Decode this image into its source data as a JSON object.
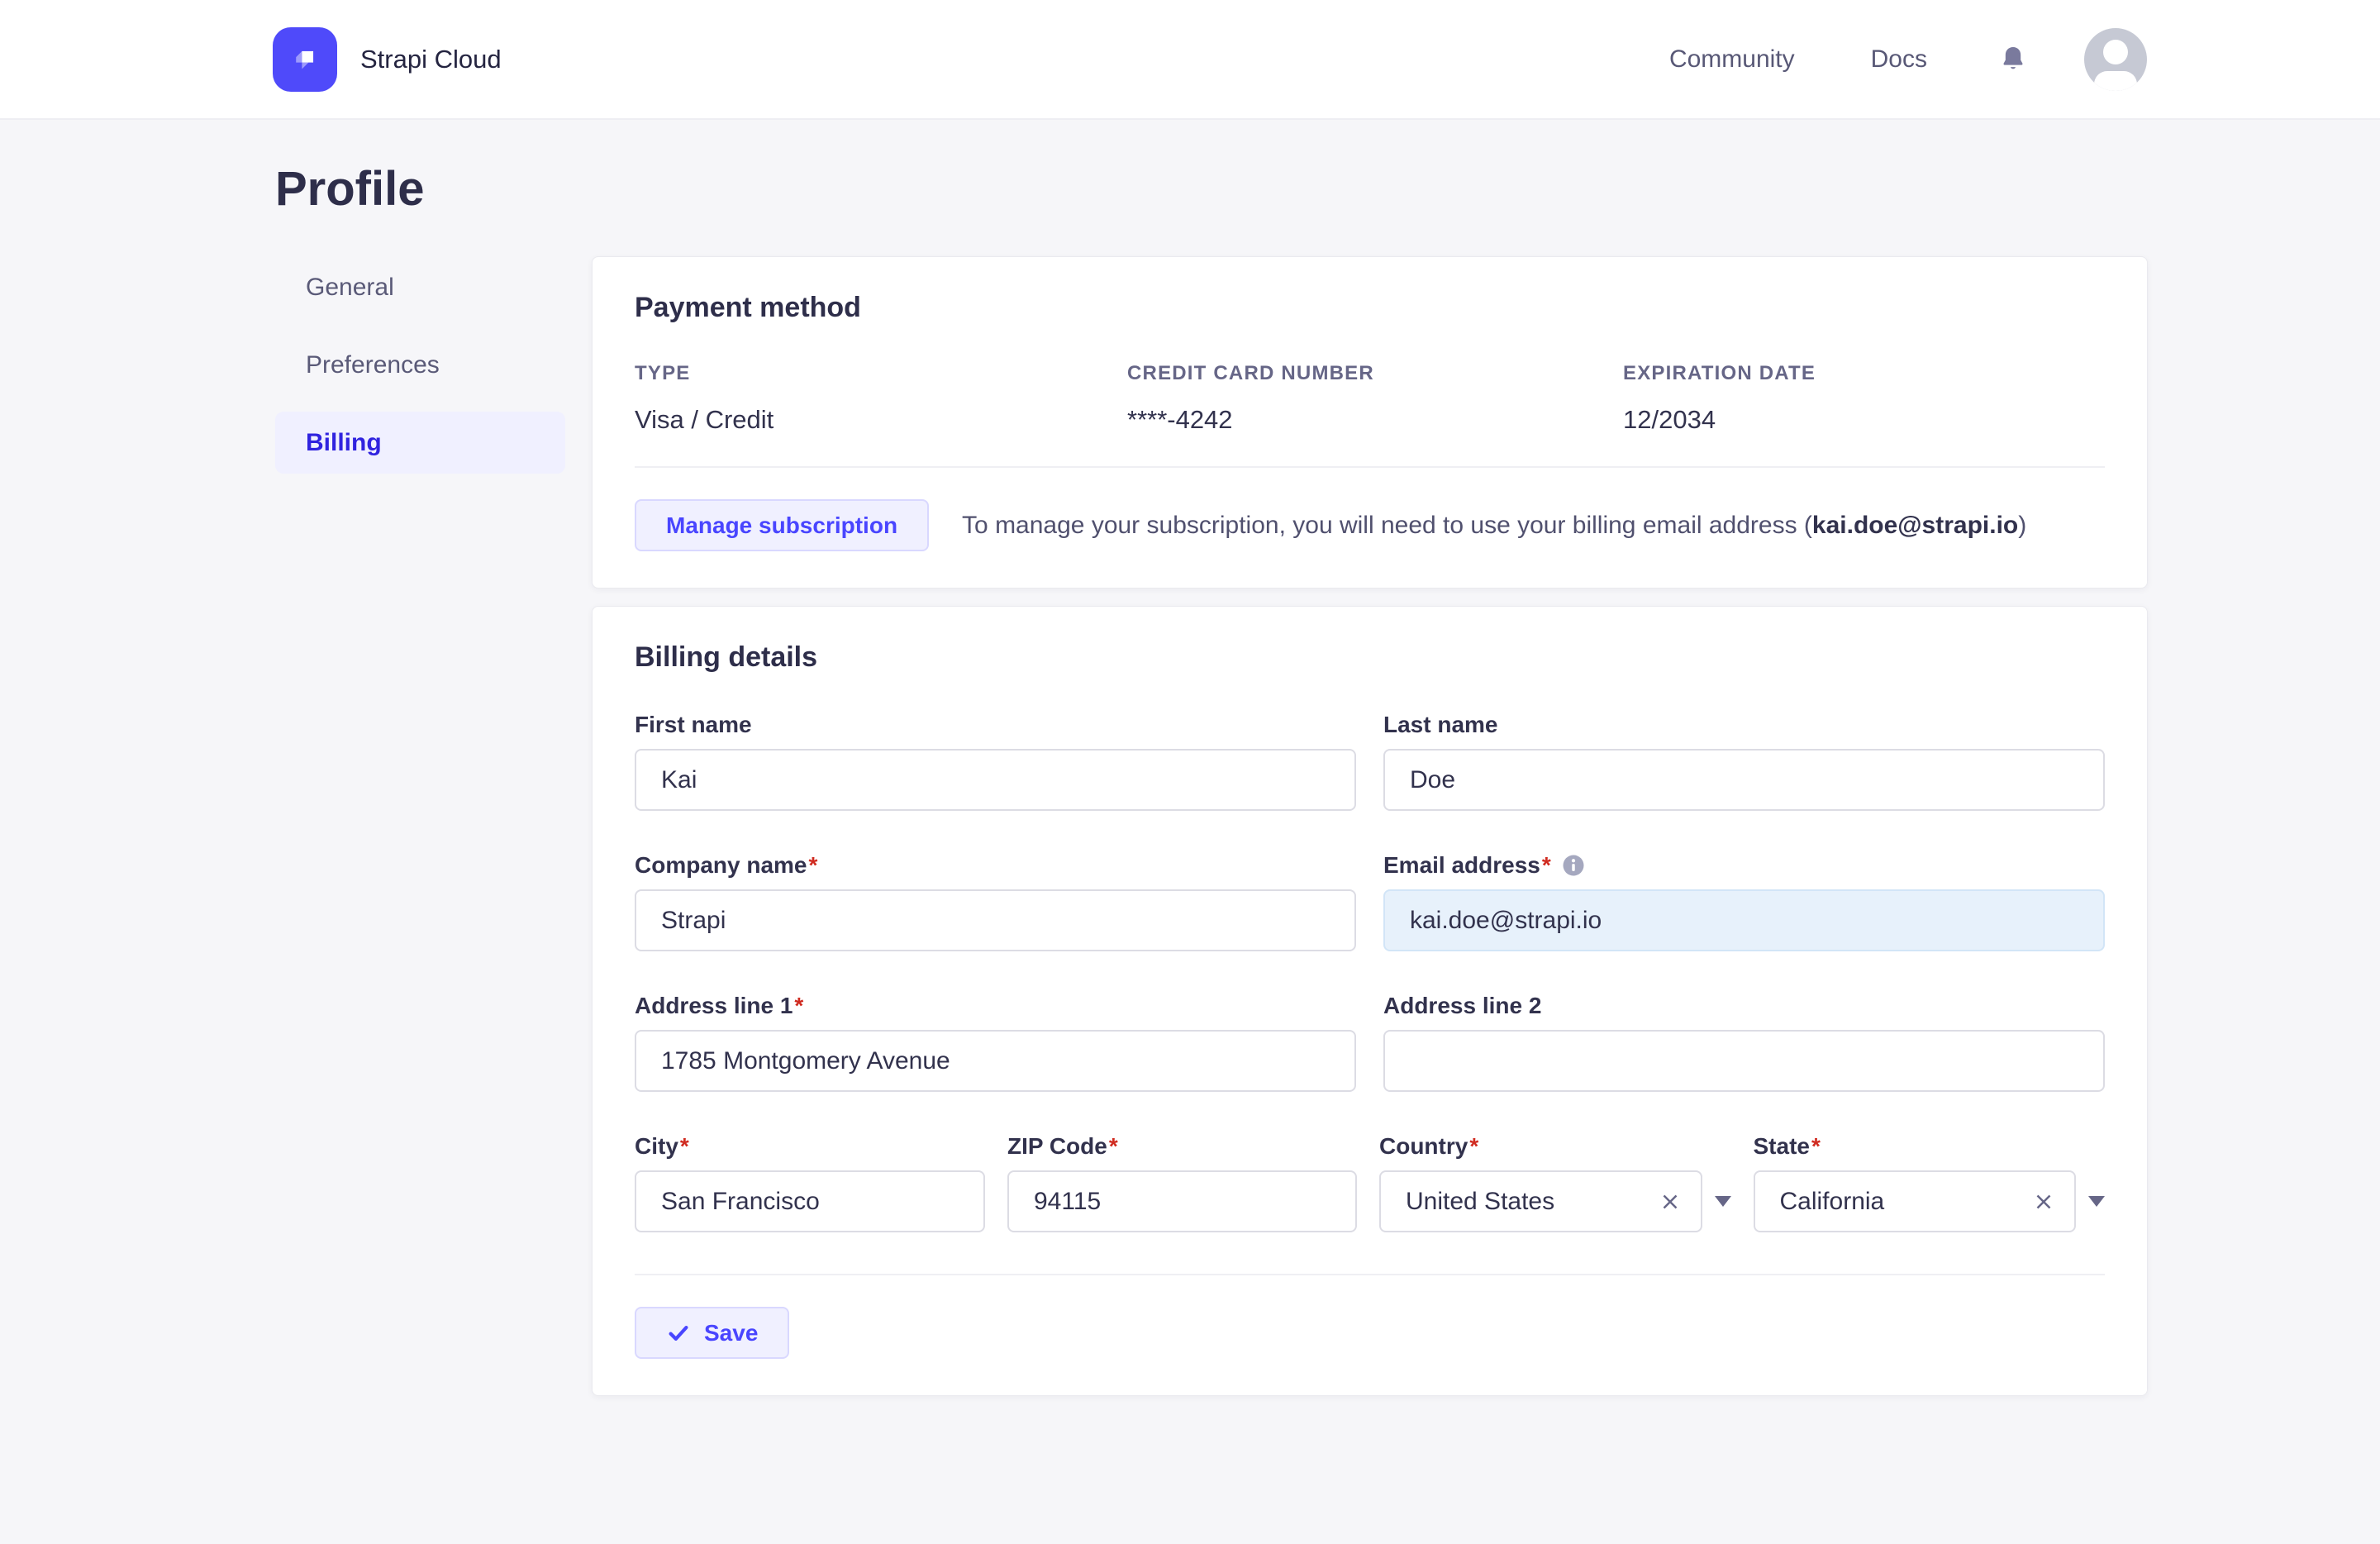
{
  "ui": {
    "required_mark": "*"
  },
  "colors": {
    "accent": "#4945FF",
    "accent_bg": "#F0F0FF",
    "accent_border": "#D9D8FF",
    "active_link": "#3023DF",
    "text_dark": "#32324D",
    "text_gray": "#666687",
    "danger": "#D02B20",
    "page_bg": "#F6F6F9",
    "email_field_bg": "#E7F1FB"
  },
  "header": {
    "brand": "Strapi Cloud",
    "nav": [
      {
        "label": "Community"
      },
      {
        "label": "Docs"
      }
    ]
  },
  "page_title": "Profile",
  "sidebar": {
    "items": [
      {
        "label": "General"
      },
      {
        "label": "Preferences"
      },
      {
        "label": "Billing"
      }
    ]
  },
  "payment": {
    "title": "Payment method",
    "fields": [
      {
        "label": "TYPE",
        "value": "Visa / Credit"
      },
      {
        "label": "CREDIT CARD NUMBER",
        "value": "****-4242"
      },
      {
        "label": "EXPIRATION DATE",
        "value": "12/2034"
      }
    ],
    "manage_button": "Manage subscription",
    "note_prefix": "To manage your subscription, you will need to use your billing email address (",
    "note_email": "kai.doe@strapi.io",
    "note_suffix": ")"
  },
  "billing": {
    "title": "Billing details",
    "first_name": {
      "label": "First name",
      "value": "Kai"
    },
    "last_name": {
      "label": "Last name",
      "value": "Doe"
    },
    "company": {
      "label": "Company name",
      "value": "Strapi"
    },
    "email": {
      "label": "Email address",
      "value": "kai.doe@strapi.io"
    },
    "address1": {
      "label": "Address line 1",
      "value": "1785 Montgomery Avenue"
    },
    "address2": {
      "label": "Address line 2",
      "value": ""
    },
    "city": {
      "label": "City",
      "value": "San Francisco"
    },
    "zip": {
      "label": "ZIP Code",
      "value": "94115"
    },
    "country": {
      "label": "Country",
      "value": "United States"
    },
    "state": {
      "label": "State",
      "value": "California"
    },
    "save_label": "Save"
  }
}
